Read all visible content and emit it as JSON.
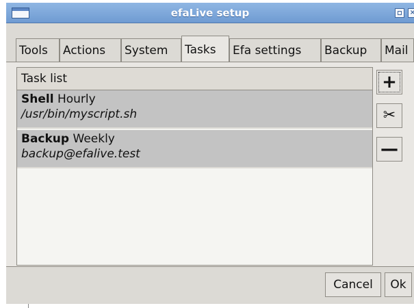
{
  "window": {
    "title": "efaLive setup"
  },
  "tabs": [
    {
      "label": "Tools"
    },
    {
      "label": "Actions"
    },
    {
      "label": "System"
    },
    {
      "label": "Tasks"
    },
    {
      "label": "Efa settings"
    },
    {
      "label": "Backup"
    },
    {
      "label": "Mail"
    }
  ],
  "active_tab": "Tasks",
  "task_list": {
    "header": "Task list",
    "items": [
      {
        "name": "Shell",
        "interval": "Hourly",
        "detail": "/usr/bin/myscript.sh"
      },
      {
        "name": "Backup",
        "interval": "Weekly",
        "detail": "backup@efalive.test"
      }
    ]
  },
  "side_buttons": {
    "add": "+",
    "edit": "✂",
    "remove": "—"
  },
  "footer": {
    "cancel_label": "Cancel",
    "ok_label": "Ok"
  },
  "colors": {
    "titlebar": "#7aa5da",
    "window_bg": "#dcdad5",
    "row_bg": "#c3c3c3",
    "list_bg": "#f5f5f2"
  }
}
